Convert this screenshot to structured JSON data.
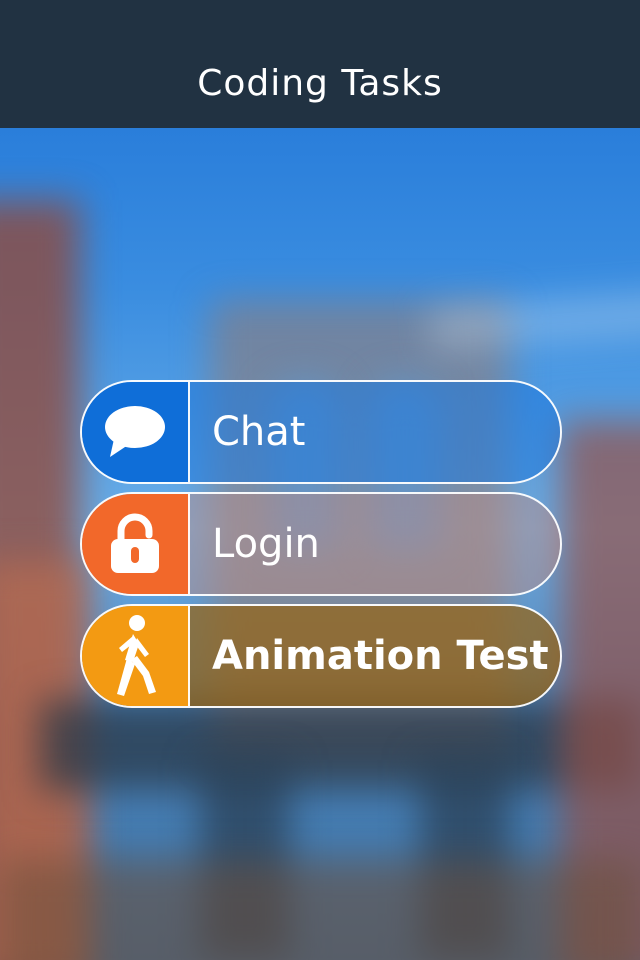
{
  "header": {
    "title": "Coding Tasks"
  },
  "menu": {
    "items": [
      {
        "label": "Chat",
        "icon": "speech-bubble-icon",
        "accent": "#0f6ed8"
      },
      {
        "label": "Login",
        "icon": "padlock-icon",
        "accent": "#f2682a"
      },
      {
        "label": "Animation Test",
        "icon": "walking-person-icon",
        "accent": "#f39a12"
      }
    ]
  },
  "colors": {
    "header_bg": "#213242"
  }
}
